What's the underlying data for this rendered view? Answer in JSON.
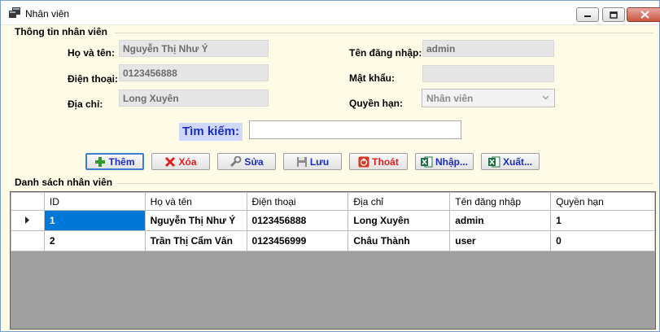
{
  "window": {
    "title": "Nhân viên",
    "icon": "window-app-icon"
  },
  "info_group": {
    "title": "Thông tin nhân viên",
    "name_label": "Họ và tên:",
    "name_value": "Nguyễn Thị Như Ý",
    "phone_label": "Điện thoại:",
    "phone_value": "0123456888",
    "address_label": "Địa chỉ:",
    "address_value": "Long Xuyên",
    "username_label": "Tên đăng nhập:",
    "username_value": "admin",
    "password_label": "Mật khẩu:",
    "password_value": "",
    "role_label": "Quyền hạn:",
    "role_value": "Nhân viên"
  },
  "search": {
    "label": "Tìm kiếm:",
    "value": ""
  },
  "buttons": {
    "add": "Thêm",
    "delete": "Xóa",
    "edit": "Sửa",
    "save": "Lưu",
    "exit": "Thoát",
    "import": "Nhập...",
    "export": "Xuất..."
  },
  "colors": {
    "accent_red": "#e02020",
    "selection_blue": "#0078d7",
    "excel_green": "#1d6f42"
  },
  "list_group": {
    "title": "Danh sách nhân viên",
    "columns": [
      "ID",
      "Họ và tên",
      "Điện thoại",
      "Địa chỉ",
      "Tên đăng nhập",
      "Quyền hạn"
    ],
    "rows": [
      [
        "1",
        "Nguyễn Thị Như Ý",
        "0123456888",
        "Long Xuyên",
        "admin",
        "1"
      ],
      [
        "2",
        "Trần Thị Cẩm Vân",
        "0123456999",
        "Châu Thành",
        "user",
        "0"
      ]
    ]
  }
}
